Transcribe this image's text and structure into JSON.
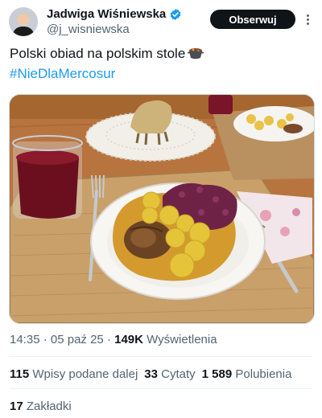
{
  "post": {
    "author": {
      "name": "Jadwiga Wiśniewska",
      "handle": "@j_wisniewska",
      "verified": true
    },
    "follow_label": "Obserwuj",
    "text_line1": "Polski obiad na polskim stole",
    "text_emoji": "pot-of-food-icon",
    "hashtag": "#NieDlaMercosur",
    "media_alt": "photo-plate-dinner",
    "time": "14:35",
    "separator": "·",
    "date": "05 paź 25",
    "views_count": "149K",
    "views_label": "Wyświetlenia",
    "reposts_count": "115",
    "reposts_label": "Wpisy podane dalej",
    "quotes_count": "33",
    "quotes_label": "Cytaty",
    "likes_count": "1 589",
    "likes_label": "Polubienia",
    "bookmarks_count": "17",
    "bookmarks_label": "Zakładki"
  },
  "colors": {
    "accent": "#1d9bf0",
    "text": "#0f1419",
    "secondary": "#536471",
    "button_bg": "#0f1419"
  }
}
